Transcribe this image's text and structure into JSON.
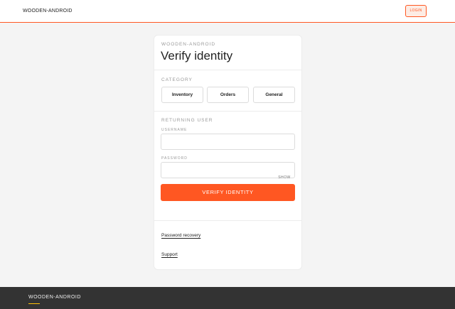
{
  "header": {
    "brand": "WOODEN-ANDROID",
    "login_label": "LOGIN"
  },
  "card": {
    "eyebrow": "WOODEN-ANDROID",
    "title": "Verify identity",
    "category": {
      "label": "CATEGORY",
      "options": [
        "Inventory",
        "Orders",
        "General"
      ]
    },
    "returning_user": {
      "label": "RETURNING USER",
      "username_label": "USERNAME",
      "username_value": "",
      "password_label": "PASSWORD",
      "password_value": "",
      "show_label": "SHOW",
      "submit_label": "VERIFY IDENTITY"
    },
    "links": {
      "password_recovery": "Password recovery",
      "support": "Support"
    }
  },
  "footer": {
    "brand": "WOODEN-ANDROID"
  },
  "colors": {
    "accent": "#ff5722",
    "footer_bg": "#333333",
    "footer_accent": "#ffc107"
  }
}
